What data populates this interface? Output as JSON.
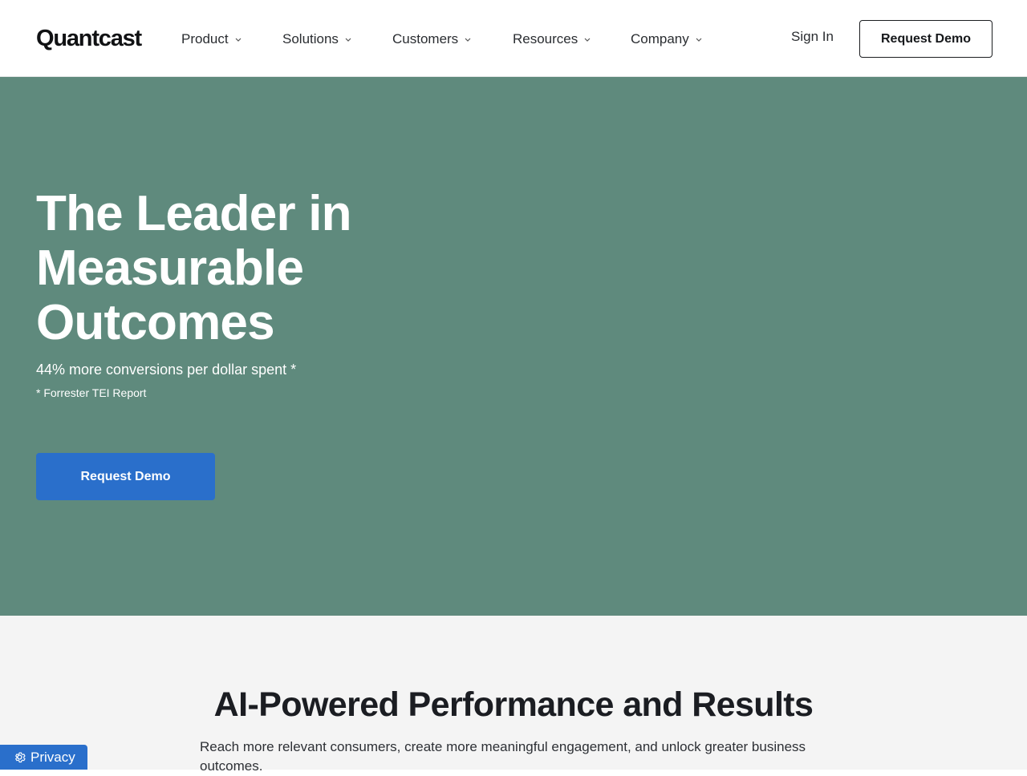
{
  "header": {
    "logo": "Quantcast",
    "nav": [
      {
        "label": "Product"
      },
      {
        "label": "Solutions"
      },
      {
        "label": "Customers"
      },
      {
        "label": "Resources"
      },
      {
        "label": "Company"
      }
    ],
    "sign_in": "Sign In",
    "request_demo": "Request Demo"
  },
  "hero": {
    "title_lines": [
      "The Leader in",
      "Measurable",
      "Outcomes"
    ],
    "stat": "44% more conversions per dollar spent *",
    "footnote": "* Forrester TEI Report",
    "cta": "Request Demo",
    "background": "#5f8a7d"
  },
  "section": {
    "title": "AI-Powered Performance and Results",
    "text": "Reach more relevant consumers, create more meaningful engagement, and unlock greater business outcomes."
  },
  "privacy": {
    "label": "Privacy",
    "icon": "gear-icon"
  },
  "colors": {
    "accent": "#2a6fcb",
    "hero_bg": "#5f8a7d",
    "section_bg": "#f4f4f4"
  }
}
